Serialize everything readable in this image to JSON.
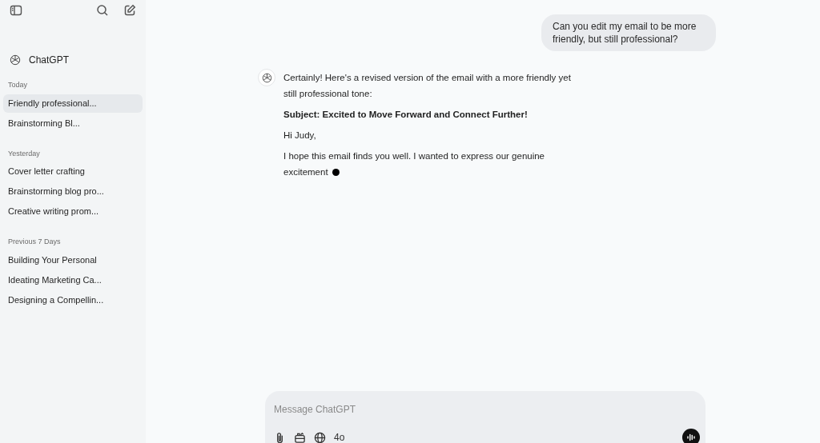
{
  "sidebar": {
    "brand": "ChatGPT",
    "groups": [
      {
        "heading": "Today",
        "items": [
          {
            "label": "Friendly professional...",
            "selected": true
          },
          {
            "label": "Brainstorming Bl...",
            "selected": false
          }
        ]
      },
      {
        "heading": "Yesterday",
        "items": [
          {
            "label": "Cover letter crafting",
            "selected": false
          },
          {
            "label": "Brainstorming blog pro...",
            "selected": false
          },
          {
            "label": "Creative writing prom...",
            "selected": false
          }
        ]
      },
      {
        "heading": "Previous 7 Days",
        "items": [
          {
            "label": "Building Your Personal",
            "selected": false
          },
          {
            "label": "Ideating Marketing Ca...",
            "selected": false
          },
          {
            "label": "Designing a Compellin...",
            "selected": false
          }
        ]
      }
    ]
  },
  "user_message": {
    "text": "Can you edit my email to be more friendly, but still professional?"
  },
  "assistant_message": {
    "streaming": true,
    "paragraphs": [
      {
        "kind": "text",
        "text": "Certainly! Here's a revised version of the email with a more friendly yet still professional tone:"
      },
      {
        "kind": "bold",
        "text": "Subject: Excited to Move Forward and Connect Further!"
      },
      {
        "kind": "text",
        "text": "Hi Judy,"
      },
      {
        "kind": "text",
        "text": "I hope this email finds you well. I wanted to express our genuine excitement"
      }
    ]
  },
  "composer": {
    "placeholder": "Message ChatGPT",
    "model": "4o"
  }
}
